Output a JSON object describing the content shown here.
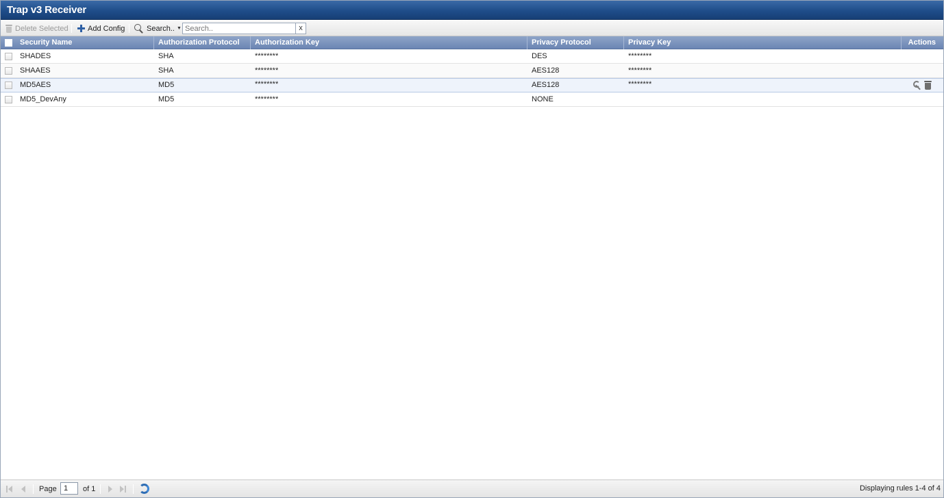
{
  "window": {
    "title": "Trap v3 Receiver"
  },
  "toolbar": {
    "delete_label": "Delete Selected",
    "add_label": "Add Config",
    "search_menu_label": "Search..",
    "search_placeholder": "Search..",
    "search_clear": "x"
  },
  "grid": {
    "columns": [
      {
        "key": "security_name",
        "label": "Security Name"
      },
      {
        "key": "auth_protocol",
        "label": "Authorization Protocol"
      },
      {
        "key": "auth_key",
        "label": "Authorization Key"
      },
      {
        "key": "privacy_protocol",
        "label": "Privacy Protocol"
      },
      {
        "key": "privacy_key",
        "label": "Privacy Key"
      },
      {
        "key": "actions",
        "label": "Actions"
      }
    ],
    "rows": [
      {
        "security_name": "SHADES",
        "auth_protocol": "SHA",
        "auth_key": "********",
        "privacy_protocol": "DES",
        "privacy_key": "********"
      },
      {
        "security_name": "SHAAES",
        "auth_protocol": "SHA",
        "auth_key": "********",
        "privacy_protocol": "AES128",
        "privacy_key": "********"
      },
      {
        "security_name": "MD5AES",
        "auth_protocol": "MD5",
        "auth_key": "********",
        "privacy_protocol": "AES128",
        "privacy_key": "********"
      },
      {
        "security_name": "MD5_DevAny",
        "auth_protocol": "MD5",
        "auth_key": "********",
        "privacy_protocol": "NONE",
        "privacy_key": ""
      }
    ],
    "row_actions": {
      "edit_icon": "wrench-icon",
      "delete_icon": "trash-icon"
    }
  },
  "pager": {
    "page_label": "Page",
    "page_value": "1",
    "of_label": "of 1",
    "display_text": "Displaying rules 1-4 of 4"
  },
  "colors": {
    "title_bar": "#1f4d8a",
    "header": "#7b93bd",
    "accent": "#2e5fa4"
  }
}
